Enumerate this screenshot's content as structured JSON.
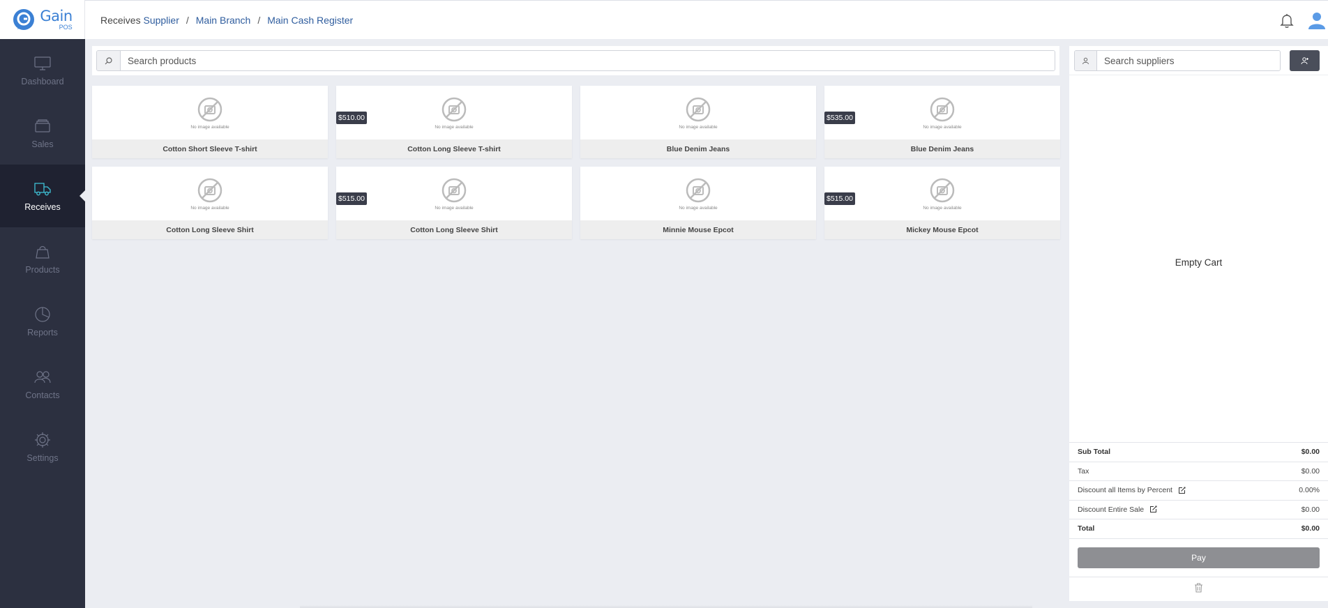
{
  "brand": {
    "name": "Gain",
    "sub": "POS",
    "color": "#3b80d4"
  },
  "breadcrumb": {
    "plain": "Receives",
    "link1": "Supplier",
    "sep": "/",
    "link2": "Main Branch",
    "link3": "Main Cash Register"
  },
  "sidebar": {
    "items": [
      {
        "label": "Dashboard",
        "icon": "monitor-icon",
        "active": false
      },
      {
        "label": "Sales",
        "icon": "cards-icon",
        "active": false
      },
      {
        "label": "Receives",
        "icon": "truck-icon",
        "active": true
      },
      {
        "label": "Products",
        "icon": "bag-icon",
        "active": false
      },
      {
        "label": "Reports",
        "icon": "pie-chart-icon",
        "active": false
      },
      {
        "label": "Contacts",
        "icon": "users-icon",
        "active": false
      },
      {
        "label": "Settings",
        "icon": "gear-icon",
        "active": false
      }
    ]
  },
  "search": {
    "placeholder": "Search products"
  },
  "products": [
    {
      "name": "Cotton Short Sleeve T-shirt",
      "price": "",
      "image_text": "No image available"
    },
    {
      "name": "Cotton Long Sleeve T-shirt",
      "price": "$510.00",
      "image_text": "No image available"
    },
    {
      "name": "Blue Denim Jeans",
      "price": "",
      "image_text": "No image available"
    },
    {
      "name": "Blue Denim Jeans",
      "price": "$535.00",
      "image_text": "No image available"
    },
    {
      "name": "Cotton Long Sleeve Shirt",
      "price": "",
      "image_text": "No image available"
    },
    {
      "name": "Cotton Long Sleeve Shirt",
      "price": "$515.00",
      "image_text": "No image available"
    },
    {
      "name": "Minnie Mouse Epcot",
      "price": "",
      "image_text": "No image available"
    },
    {
      "name": "Mickey Mouse Epcot",
      "price": "$515.00",
      "image_text": "No image available"
    }
  ],
  "cart": {
    "search_placeholder": "Search suppliers",
    "empty_text": "Empty Cart",
    "subtotal_label": "Sub Total",
    "subtotal": "$0.00",
    "tax_label": "Tax",
    "tax": "$0.00",
    "discount_pct_label": "Discount all Items by Percent",
    "discount_pct": "0.00%",
    "discount_sale_label": "Discount Entire Sale",
    "discount_sale": "$0.00",
    "total_label": "Total",
    "total": "$0.00",
    "pay_label": "Pay"
  },
  "colors": {
    "sidebar": "#2c3040",
    "sidebar_active": "#1f2231",
    "accent_icon": "#3fc3d8",
    "link": "#2f5d9e"
  }
}
